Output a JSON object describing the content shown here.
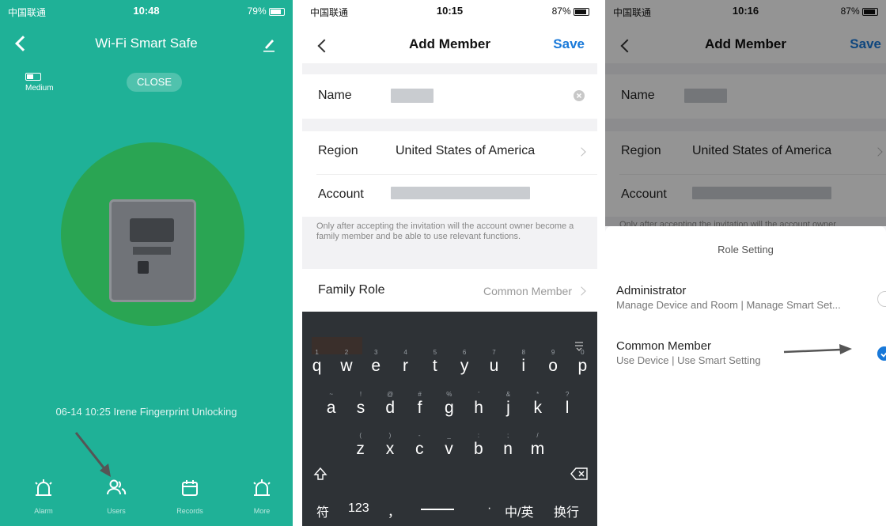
{
  "colors": {
    "teal": "#1fb197",
    "circle": "#2aa553",
    "link_blue": "#1979d9"
  },
  "panel1": {
    "status": {
      "carrier": "中国联通",
      "time": "10:48",
      "battery": "79%"
    },
    "title": "Wi-Fi Smart Safe",
    "battery_level_label": "Medium",
    "close_label": "CLOSE",
    "log": "06-14 10:25  Irene Fingerprint Unlocking",
    "tabs": [
      {
        "label": "Alarm",
        "icon": "alarm-icon"
      },
      {
        "label": "Users",
        "icon": "users-icon"
      },
      {
        "label": "Records",
        "icon": "calendar-icon"
      },
      {
        "label": "More",
        "icon": "alarm-icon"
      }
    ]
  },
  "panel2": {
    "status": {
      "carrier": "中国联通",
      "time": "10:15",
      "battery": "87%"
    },
    "title": "Add Member",
    "save": "Save",
    "name_label": "Name",
    "region_label": "Region",
    "region_value": "United States of America",
    "account_label": "Account",
    "hint": "Only after accepting the invitation will the account owner become a family member and be able to use relevant functions.",
    "role_label": "Family Role",
    "role_value": "Common Member",
    "keyboard": {
      "row1": [
        {
          "num": "1",
          "ch": "q"
        },
        {
          "num": "2",
          "ch": "w"
        },
        {
          "num": "3",
          "ch": "e"
        },
        {
          "num": "4",
          "ch": "r"
        },
        {
          "num": "5",
          "ch": "t"
        },
        {
          "num": "6",
          "ch": "y"
        },
        {
          "num": "7",
          "ch": "u"
        },
        {
          "num": "8",
          "ch": "i"
        },
        {
          "num": "9",
          "ch": "o"
        },
        {
          "num": "0",
          "ch": "p"
        }
      ],
      "row2": [
        {
          "num": "~",
          "ch": "a"
        },
        {
          "num": "!",
          "ch": "s"
        },
        {
          "num": "@",
          "ch": "d"
        },
        {
          "num": "#",
          "ch": "f"
        },
        {
          "num": "%",
          "ch": "g"
        },
        {
          "num": "'",
          "ch": "h"
        },
        {
          "num": "&",
          "ch": "j"
        },
        {
          "num": "*",
          "ch": "k"
        },
        {
          "num": "?",
          "ch": "l"
        }
      ],
      "row3": [
        {
          "num": "(",
          "ch": "z"
        },
        {
          "num": ")",
          "ch": "x"
        },
        {
          "num": "-",
          "ch": "c"
        },
        {
          "num": "_",
          "ch": "v"
        },
        {
          "num": ":",
          "ch": "b"
        },
        {
          "num": ";",
          "ch": "n"
        },
        {
          "num": "/",
          "ch": "m"
        }
      ],
      "sym_key": "符",
      "num_key": "123",
      "comma_key": "，",
      "period_key": "·",
      "lang_key": "中/英",
      "return_key": "换行"
    }
  },
  "panel3": {
    "status": {
      "carrier": "中国联通",
      "time": "10:16",
      "battery": "87%"
    },
    "title": "Add Member",
    "save": "Save",
    "name_label": "Name",
    "region_label": "Region",
    "region_value": "United States of America",
    "account_label": "Account",
    "hint_partial": "Only after accepting the invitation will the account owner",
    "sheet_title": "Role Setting",
    "options": [
      {
        "name": "Administrator",
        "desc": "Manage Device and Room | Manage Smart Set...",
        "selected": false
      },
      {
        "name": "Common Member",
        "desc": "Use Device | Use Smart Setting",
        "selected": true
      }
    ]
  }
}
